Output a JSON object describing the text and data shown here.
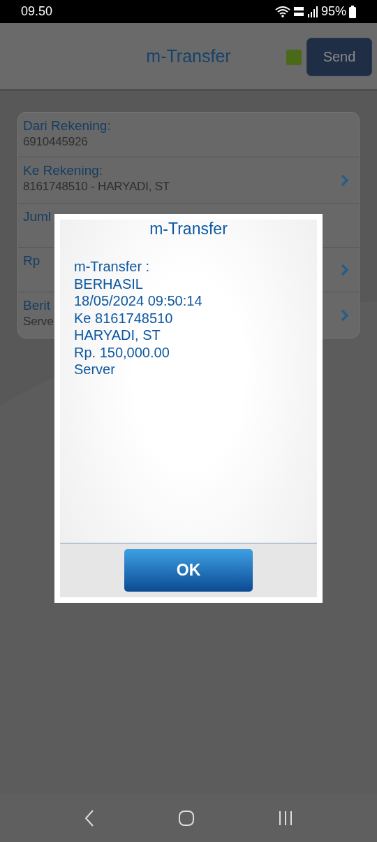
{
  "status_bar": {
    "time": "09.50",
    "battery": "95%"
  },
  "header": {
    "title": "m-Transfer",
    "send_button": "Send"
  },
  "form": {
    "rows": [
      {
        "label": "Dari Rekening:",
        "value": "6910445926",
        "chevron": false
      },
      {
        "label": "Ke Rekening:",
        "value": "8161748510 - HARYADI, ST",
        "chevron": true
      },
      {
        "label": "Juml",
        "chevron": false
      },
      {
        "label": "Rp",
        "chevron": true
      },
      {
        "label": "Berit",
        "value": "Serve",
        "chevron": true
      }
    ]
  },
  "dialog": {
    "title": "m-Transfer",
    "message_lines": [
      "m-Transfer :",
      "BERHASIL",
      "18/05/2024 09:50:14",
      "Ke 8161748510",
      "HARYADI, ST",
      "Rp. 150,000.00",
      "Server"
    ],
    "ok_button": "OK"
  }
}
